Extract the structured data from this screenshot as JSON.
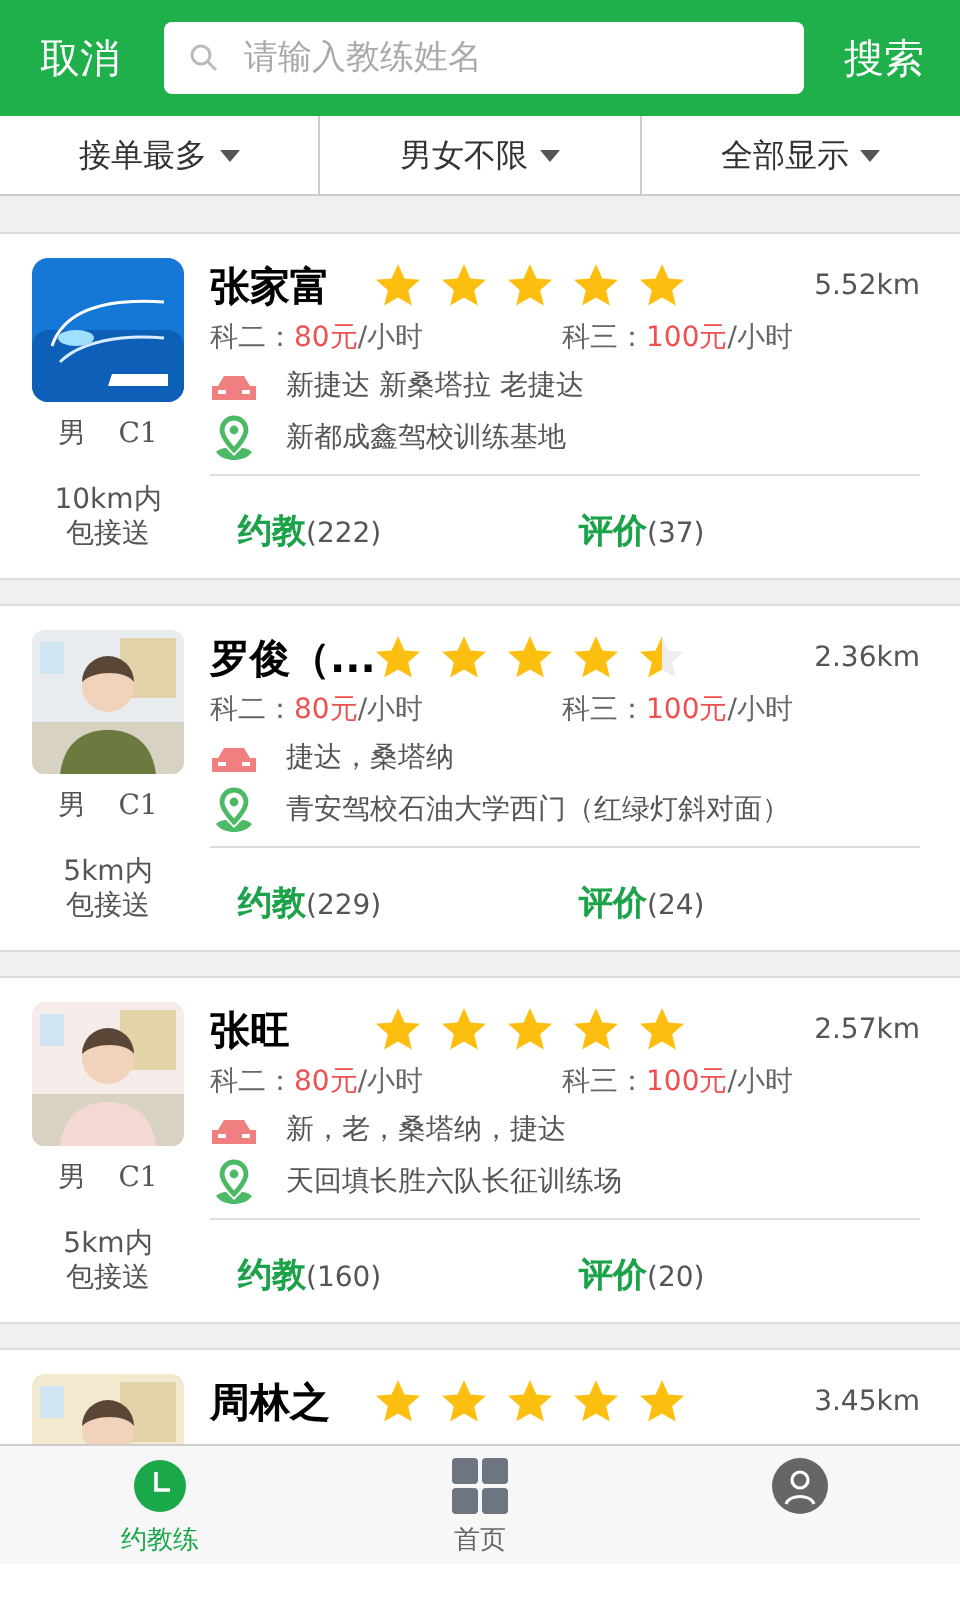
{
  "header": {
    "cancel": "取消",
    "search_placeholder": "请输入教练姓名",
    "search_button": "搜索"
  },
  "filters": [
    {
      "label": "接单最多"
    },
    {
      "label": "男女不限"
    },
    {
      "label": "全部显示"
    }
  ],
  "coaches": [
    {
      "name": "张家富",
      "stars": 5,
      "distance": "5.52km",
      "gender": "男",
      "license": "C1",
      "pickup": [
        "10km内",
        "包接送"
      ],
      "prices": [
        {
          "label": "科二：",
          "amount": "80元",
          "unit": "/小时"
        },
        {
          "label": "科三：",
          "amount": "100元",
          "unit": "/小时"
        }
      ],
      "cars": "新捷达 新桑塔拉 老捷达",
      "location": "新都成鑫驾校训练基地",
      "book": {
        "label": "约教",
        "count": "(222)"
      },
      "review": {
        "label": "评价",
        "count": "(37)"
      }
    },
    {
      "name": "罗俊（...",
      "stars": 4.5,
      "distance": "2.36km",
      "gender": "男",
      "license": "C1",
      "pickup": [
        "5km内",
        "包接送"
      ],
      "prices": [
        {
          "label": "科二：",
          "amount": "80元",
          "unit": "/小时"
        },
        {
          "label": "科三：",
          "amount": "100元",
          "unit": "/小时"
        }
      ],
      "cars": "捷达，桑塔纳",
      "location": "青安驾校石油大学西门（红绿灯斜对面）",
      "book": {
        "label": "约教",
        "count": "(229)"
      },
      "review": {
        "label": "评价",
        "count": "(24)"
      }
    },
    {
      "name": "张旺",
      "stars": 5,
      "distance": "2.57km",
      "gender": "男",
      "license": "C1",
      "pickup": [
        "5km内",
        "包接送"
      ],
      "prices": [
        {
          "label": "科二：",
          "amount": "80元",
          "unit": "/小时"
        },
        {
          "label": "科三：",
          "amount": "100元",
          "unit": "/小时"
        }
      ],
      "cars": "新，老，桑塔纳，捷达",
      "location": "天回填长胜六队长征训练场",
      "book": {
        "label": "约教",
        "count": "(160)"
      },
      "review": {
        "label": "评价",
        "count": "(20)"
      }
    },
    {
      "name": "周林之",
      "stars": 5,
      "distance": "3.45km"
    }
  ],
  "tabs": [
    {
      "kind": "clock",
      "label": "约教练",
      "selected": true
    },
    {
      "kind": "grid",
      "label": "首页",
      "selected": false
    },
    {
      "kind": "person",
      "selected": false
    }
  ]
}
